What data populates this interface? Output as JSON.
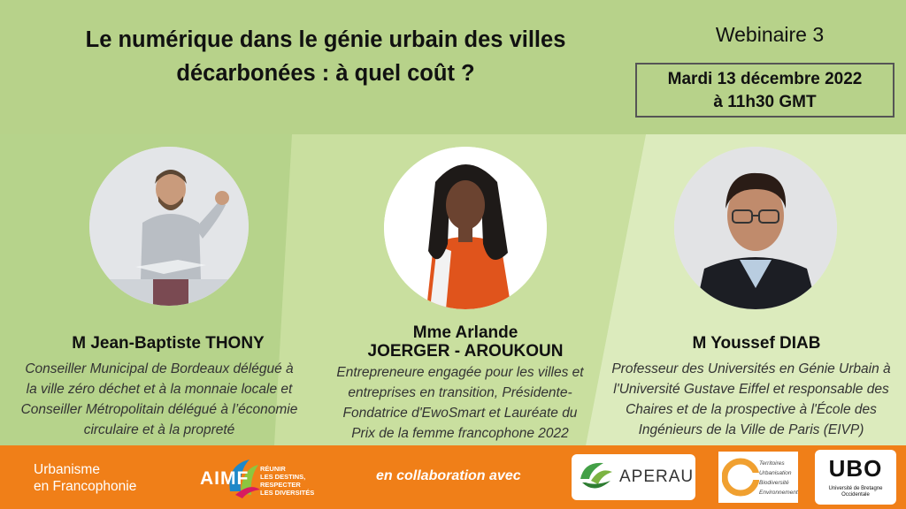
{
  "header": {
    "title_line1": "Le numérique dans le génie urbain des villes",
    "title_line2": "décarbonées : à quel coût ?",
    "webinar": "Webinaire 3",
    "date_line1": "Mardi 13 décembre 2022",
    "date_line2": "à 11h30 GMT"
  },
  "speakers": [
    {
      "name": "M Jean-Baptiste THONY",
      "desc": [
        "Conseiller Municipal de Bordeaux délégué à",
        "la ville zéro déchet et à la monnaie locale et",
        "Conseiller Métropolitain délégué à l’économie",
        "circulaire et à la propreté"
      ]
    },
    {
      "name_line1": "Mme Arlande",
      "name_line2": "JOERGER - AROUKOUN",
      "desc": [
        "Entrepreneure engagée pour les villes et",
        "entreprises en transition, Présidente-",
        "Fondatrice d'EwoSmart et Lauréate du",
        "Prix de la femme francophone 2022"
      ]
    },
    {
      "name": "M Youssef DIAB",
      "desc": [
        "Professeur des Universités en Génie Urbain à",
        "l'Université Gustave Eiffel et responsable des",
        "Chaires et de la prospective à l'École des",
        "Ingénieurs de la Ville de Paris (EIVP)"
      ]
    }
  ],
  "footer": {
    "uf_line1": "Urbanisme",
    "uf_line2": "en Francophonie",
    "aimf": "AIMF",
    "aimf_tag1": "RÉUNIR",
    "aimf_tag2": "LES DESTINS,",
    "aimf_tag3": "RESPECTER",
    "aimf_tag4": "LES DIVERSITÉS",
    "collab": "en collaboration avec",
    "aperau": "APERAU",
    "tube1": "Territoires",
    "tube2": "Urbanisation",
    "tube3": "Biodiversité",
    "tube4": "Environnement",
    "ubo": "UBO",
    "ubo_sub": "Université de Bretagne Occidentale"
  },
  "colors": {
    "header_bg": "#b7d28a",
    "footer_bg": "#f07f18",
    "accent_green": "#7cb342"
  }
}
